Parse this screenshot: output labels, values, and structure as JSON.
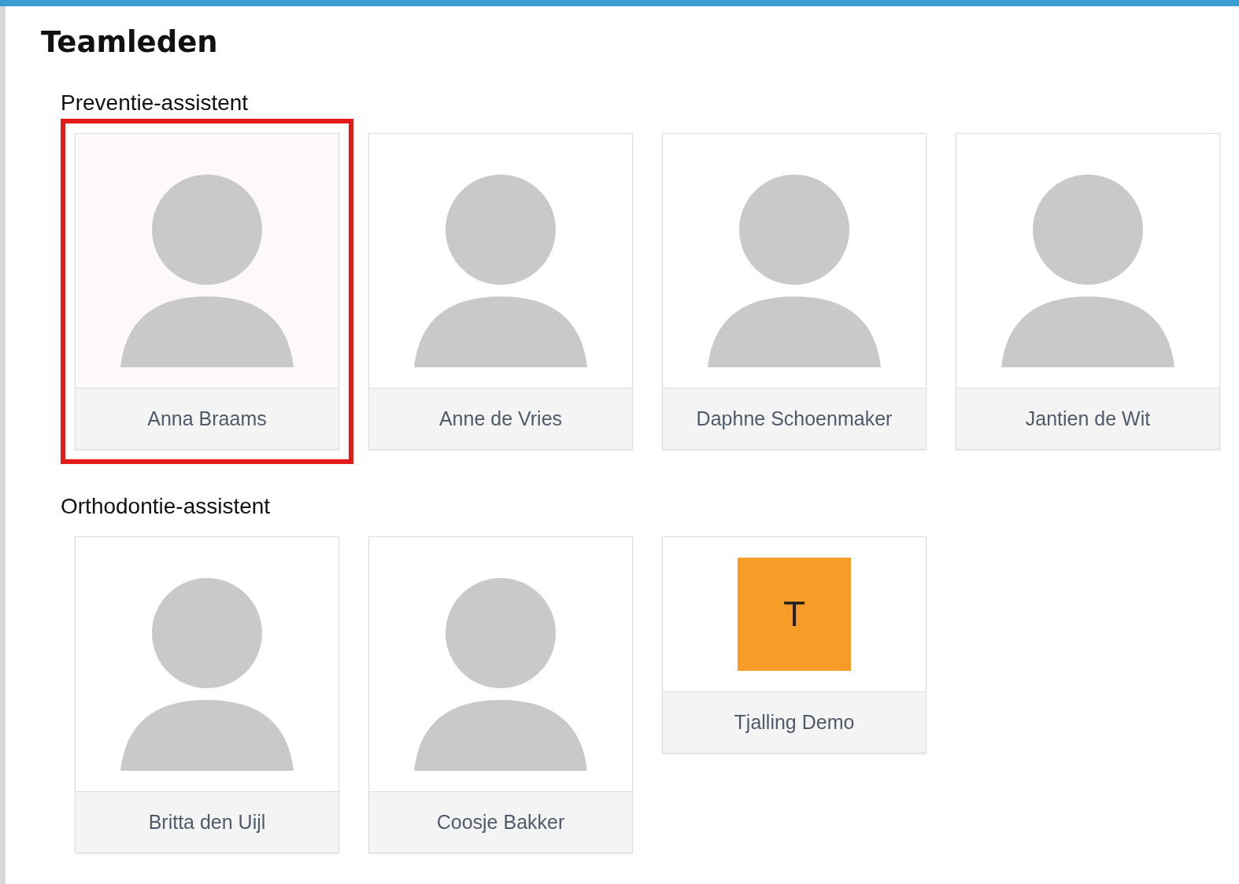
{
  "title": "Teamleden",
  "sections": [
    {
      "heading": "Preventie-assistent",
      "members": [
        {
          "name": "Anna Braams",
          "kind": "avatar",
          "selected": true
        },
        {
          "name": "Anne de Vries",
          "kind": "avatar",
          "selected": false
        },
        {
          "name": "Daphne Schoenmaker",
          "kind": "avatar",
          "selected": false
        },
        {
          "name": "Jantien de Wit",
          "kind": "avatar",
          "selected": false
        }
      ]
    },
    {
      "heading": "Orthodontie-assistent",
      "members": [
        {
          "name": "Britta den Uijl",
          "kind": "avatar",
          "selected": false
        },
        {
          "name": "Coosje Bakker",
          "kind": "avatar",
          "selected": false
        },
        {
          "name": "Tjalling Demo",
          "kind": "initial",
          "initial": "T",
          "selected": false
        }
      ]
    }
  ]
}
